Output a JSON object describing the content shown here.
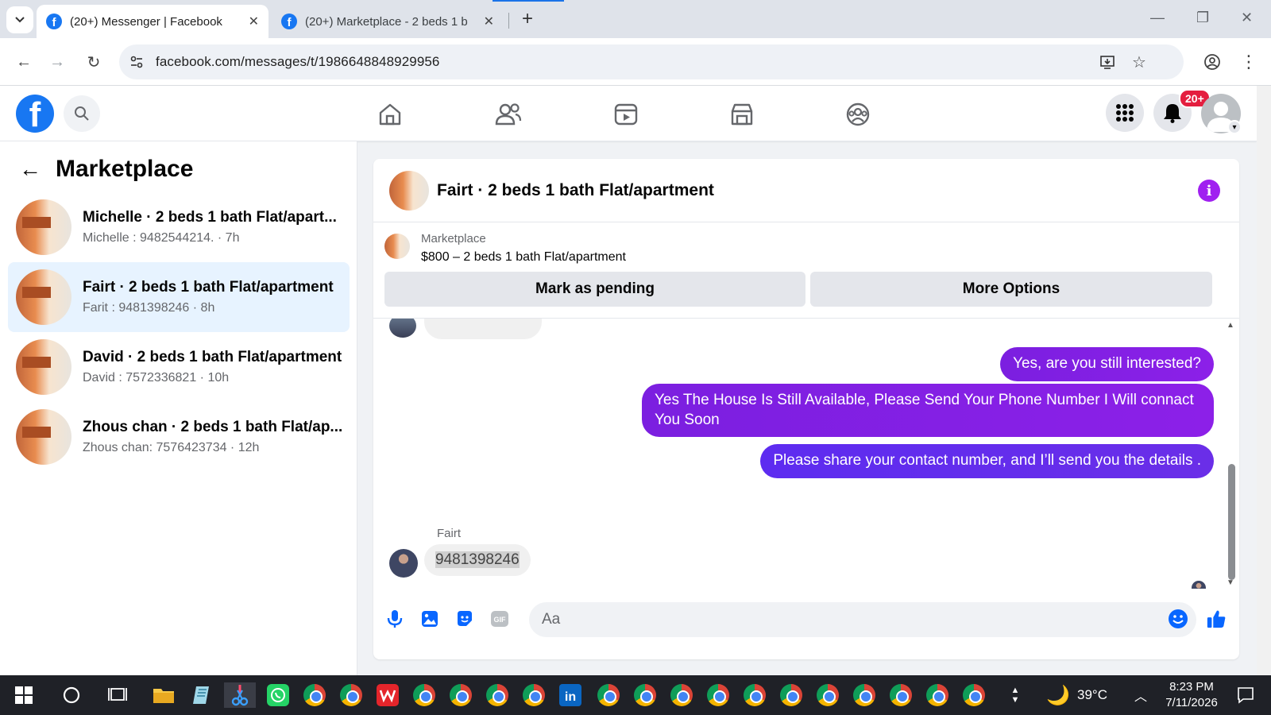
{
  "browser": {
    "tabs": [
      {
        "title": "(20+) Messenger | Facebook",
        "active": true
      },
      {
        "title": "(20+) Marketplace - 2 beds 1 b",
        "active": false
      }
    ],
    "url": "facebook.com/messages/t/1986648848929956"
  },
  "fb_header": {
    "logo": "f",
    "notification_badge": "20+",
    "nav_icons": [
      "home-icon",
      "friends-icon",
      "video-icon",
      "marketplace-icon",
      "groups-icon"
    ]
  },
  "left_panel": {
    "title": "Marketplace",
    "conversations": [
      {
        "name": "Michelle · 2 beds 1 bath Flat/apart...",
        "preview": "Michelle : 9482544214. · 7h",
        "selected": false
      },
      {
        "name": "Fairt · 2 beds 1 bath Flat/apartment",
        "preview": "Farit : 9481398246 · 8h",
        "selected": true
      },
      {
        "name": "David · 2 beds 1 bath Flat/apartment",
        "preview": "David : 7572336821 · 10h",
        "selected": false
      },
      {
        "name": "Zhous chan · 2 beds 1 bath Flat/ap...",
        "preview": "Zhous chan: 7576423734 · 12h",
        "selected": false
      }
    ]
  },
  "chat": {
    "title": "Fairt · 2 beds 1 bath Flat/apartment",
    "info_label": "i",
    "marketplace_label": "Marketplace",
    "listing": "$800 – 2 beds 1 bath Flat/apartment",
    "mark_pending": "Mark as pending",
    "more_options": "More Options",
    "messages_out": [
      "Yes, are you still interested?",
      "Yes The House Is Still Available, Please Send Your Phone Number I Will connact You Soon",
      "Please share your contact number, and I’ll send you the details ."
    ],
    "incoming_sender": "Fairt",
    "incoming_message": "9481398246",
    "composer_placeholder": "Aa",
    "colors": {
      "out_purple": "#7b1fe0",
      "out_blue": "#5d2cf0",
      "info": "#a020f0"
    }
  },
  "taskbar": {
    "weather": "39°C",
    "time": "8:23 PM",
    "date": "7/11/2026"
  }
}
